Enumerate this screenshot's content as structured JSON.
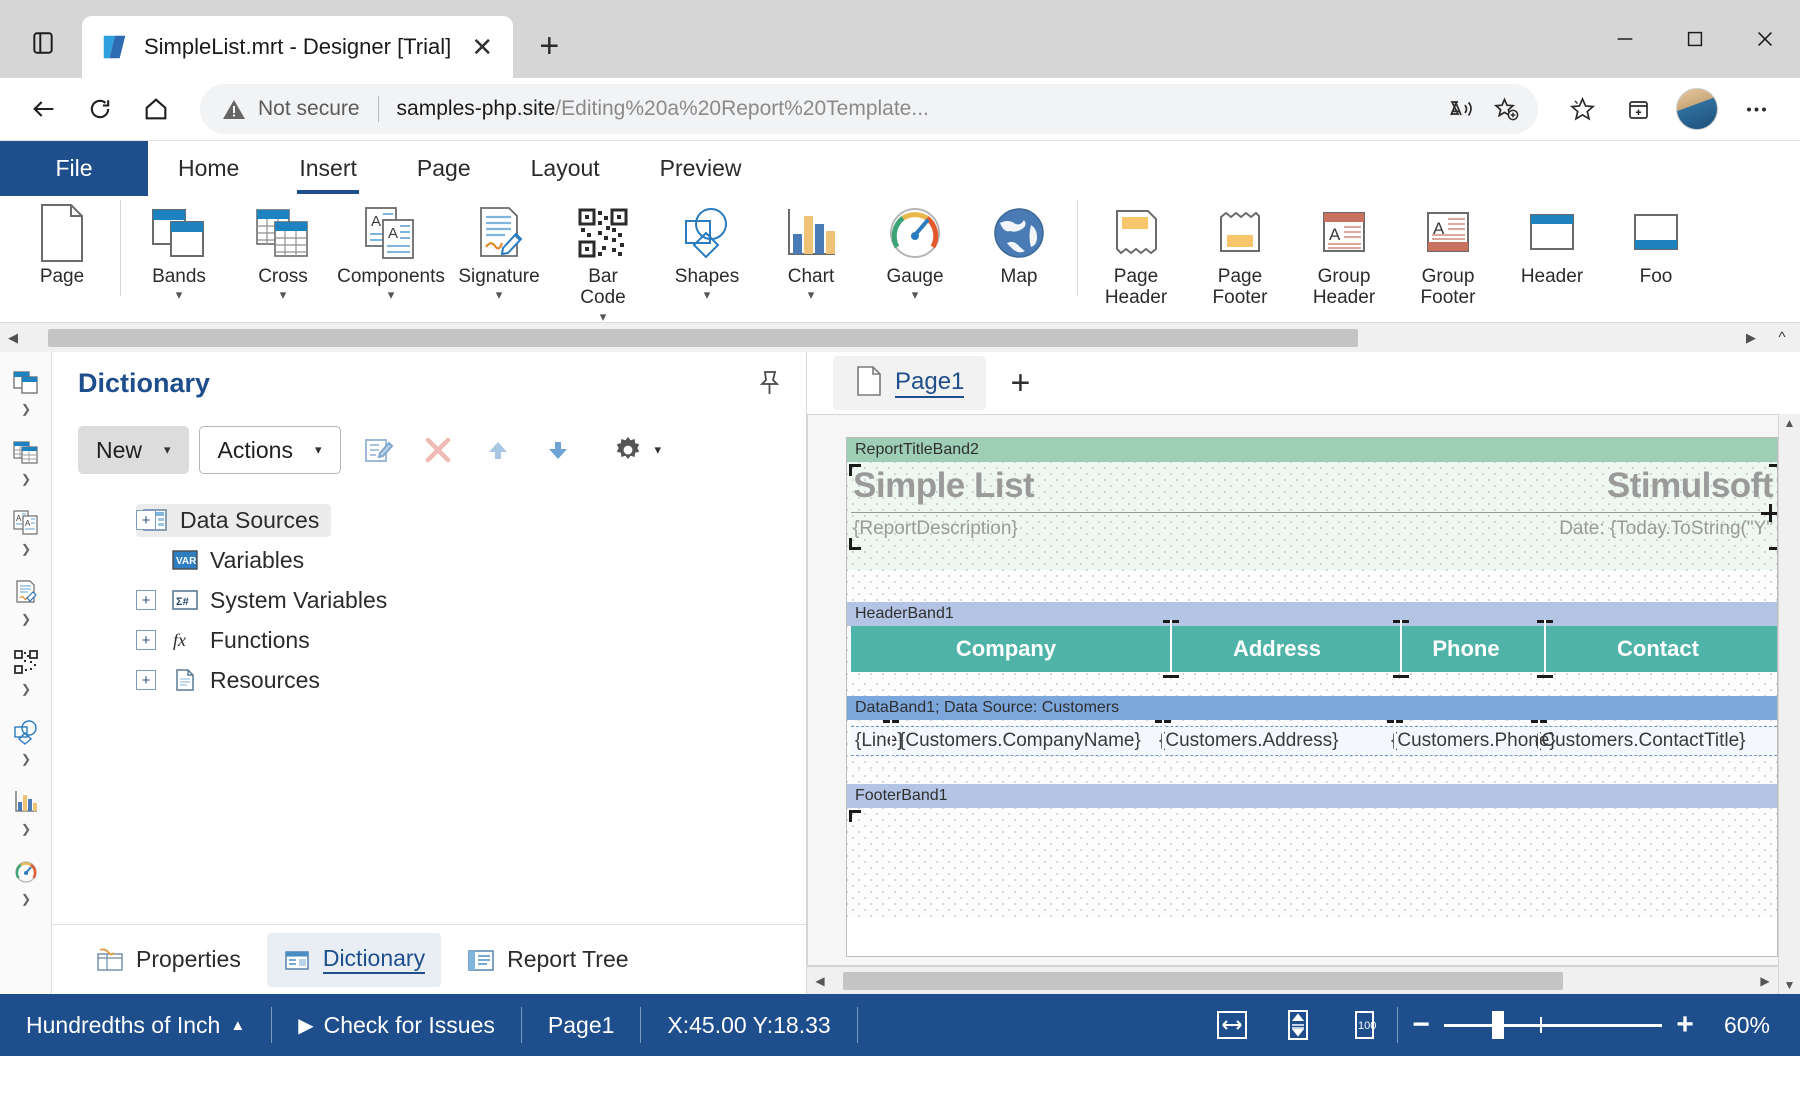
{
  "browser": {
    "tab_title": "SimpleList.mrt - Designer [Trial]",
    "security_label": "Not secure",
    "url_domain": "samples-php.site",
    "url_path": "/Editing%20a%20Report%20Template...",
    "icons": {
      "tab_strip": "tab-strip-icon",
      "favicon": "stimulsoft-favicon",
      "close_tab": "close-icon",
      "new_tab": "new-tab-icon",
      "back": "back-arrow-icon",
      "refresh": "refresh-icon",
      "home": "home-icon",
      "read_aloud": "read-aloud-icon",
      "add_favorite": "add-favorite-icon",
      "favorites": "favorites-star-icon",
      "collections": "collections-icon",
      "profile": "profile-avatar",
      "settings_more": "more-options-icon",
      "minimize": "minimize-icon",
      "maximize": "maximize-icon",
      "window_close": "window-close-icon"
    }
  },
  "ribbon": {
    "file_label": "File",
    "tabs": [
      {
        "label": "Home",
        "active": false
      },
      {
        "label": "Insert",
        "active": true
      },
      {
        "label": "Page",
        "active": false
      },
      {
        "label": "Layout",
        "active": false
      },
      {
        "label": "Preview",
        "active": false
      }
    ],
    "items": [
      {
        "label": "Page",
        "icon": "page-icon",
        "caret": false
      },
      {
        "label": "Bands",
        "icon": "bands-icon",
        "caret": true
      },
      {
        "label": "Cross",
        "icon": "cross-icon",
        "caret": true
      },
      {
        "label": "Components",
        "icon": "components-icon",
        "caret": true
      },
      {
        "label": "Signature",
        "icon": "signature-icon",
        "caret": true
      },
      {
        "label": "Bar\nCode",
        "label_line1": "Bar",
        "label_line2": "Code",
        "icon": "barcode-icon",
        "caret": true
      },
      {
        "label": "Shapes",
        "icon": "shapes-icon",
        "caret": true
      },
      {
        "label": "Chart",
        "icon": "chart-icon",
        "caret": true
      },
      {
        "label": "Gauge",
        "icon": "gauge-icon",
        "caret": true
      },
      {
        "label": "Map",
        "icon": "map-globe-icon",
        "caret": false
      },
      {
        "label_line1": "Page",
        "label_line2": "Header",
        "icon": "page-header-icon",
        "caret": false
      },
      {
        "label_line1": "Page",
        "label_line2": "Footer",
        "icon": "page-footer-icon",
        "caret": false
      },
      {
        "label_line1": "Group",
        "label_line2": "Header",
        "icon": "group-header-icon",
        "caret": false
      },
      {
        "label_line1": "Group",
        "label_line2": "Footer",
        "icon": "group-footer-icon",
        "caret": false
      },
      {
        "label": "Header",
        "icon": "header-icon",
        "caret": false
      },
      {
        "label": "Foo",
        "icon": "footer-icon",
        "caret": false
      }
    ]
  },
  "dictionary": {
    "title": "Dictionary",
    "pin_icon": "pin-icon",
    "toolbar": {
      "new_label": "New",
      "actions_label": "Actions",
      "edit_icon": "edit-icon",
      "delete_icon": "delete-x-icon",
      "move_up_icon": "arrow-up-icon",
      "move_down_icon": "arrow-down-icon",
      "gear_icon": "gear-icon"
    },
    "tree": [
      {
        "label": "Data Sources",
        "icon": "data-sources-icon",
        "expandable": true,
        "selected": true
      },
      {
        "label": "Variables",
        "icon": "variables-icon",
        "expandable": false,
        "selected": false
      },
      {
        "label": "System Variables",
        "icon": "system-variables-icon",
        "expandable": true,
        "selected": false
      },
      {
        "label": "Functions",
        "icon": "functions-fx-icon",
        "expandable": true,
        "selected": false
      },
      {
        "label": "Resources",
        "icon": "resources-icon",
        "expandable": true,
        "selected": false
      }
    ],
    "bottom_tabs": [
      {
        "label": "Properties",
        "icon": "properties-icon",
        "active": false
      },
      {
        "label": "Dictionary",
        "icon": "dictionary-icon",
        "active": true
      },
      {
        "label": "Report Tree",
        "icon": "report-tree-icon",
        "active": false
      }
    ]
  },
  "designer": {
    "page_tab": "Page1",
    "page_tab_icon": "page-doc-icon",
    "add_page_label": "+",
    "bands": [
      {
        "name": "ReportTitleBand2",
        "type": "title",
        "title_text": "Simple List",
        "title_right_text": "Stimulsoft",
        "description_text": "{ReportDescription}",
        "date_text": "Date: {Today.ToString(\"Y\"",
        "extra_right": ""
      },
      {
        "name": "HeaderBand1",
        "type": "header",
        "columns": [
          "Company",
          "Address",
          "Phone",
          "Contact"
        ]
      },
      {
        "name": "DataBand1; Data Source: Customers",
        "type": "data",
        "fields": [
          "{Line}",
          "{Customers.CompanyName}",
          "{Customers.Address}",
          "{Customers.Phone}",
          "{Customers.ContactTitle}"
        ]
      },
      {
        "name": "FooterBand1",
        "type": "footer"
      }
    ]
  },
  "statusbar": {
    "units_label": "Hundredths of Inch",
    "units_caret": "▲",
    "check_issues_label": "Check for Issues",
    "check_issues_icon": "play-triangle-icon",
    "page_label": "Page1",
    "coords_label": "X:45.00 Y:18.33",
    "view_icons": [
      "fit-width-icon",
      "fit-page-icon",
      "zoom-100-icon"
    ],
    "zoom_minus": "−",
    "zoom_plus": "+",
    "zoom_value": "60%"
  },
  "colors": {
    "accent_blue": "#1f4e8c",
    "title_band": "#9ecfb4",
    "header_band": "#b4c4e4",
    "data_band": "#7ba7dd",
    "table_header": "#4fb3a8"
  }
}
